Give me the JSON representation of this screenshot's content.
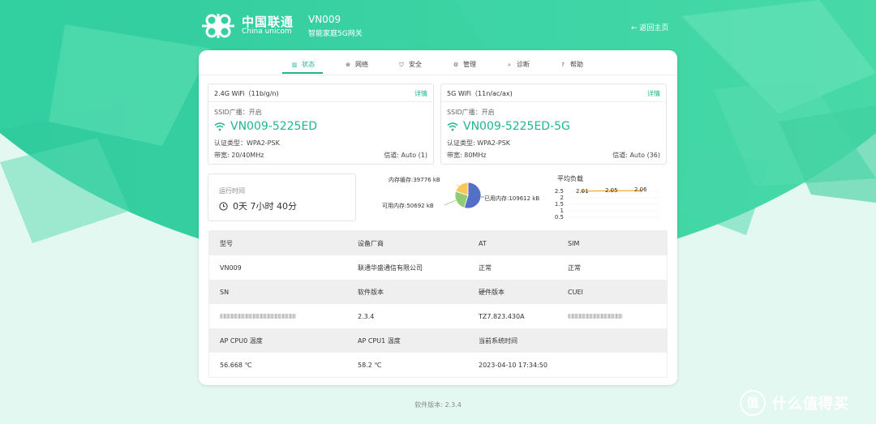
{
  "brand": {
    "name_cn": "中国联通",
    "name_en": "China unicom"
  },
  "device": {
    "model": "VN009",
    "subtitle": "智能家庭5G网关"
  },
  "nav": {
    "back_label": "返回主页"
  },
  "tabs": [
    {
      "label": "状态",
      "icon": "bar-chart-icon",
      "active": true
    },
    {
      "label": "网络",
      "icon": "globe-icon"
    },
    {
      "label": "安全",
      "icon": "shield-icon"
    },
    {
      "label": "管理",
      "icon": "gear-icon"
    },
    {
      "label": "诊断",
      "icon": "search-icon"
    },
    {
      "label": "帮助",
      "icon": "help-icon"
    }
  ],
  "wifi_24": {
    "title": "2.4G WiFi（11b/g/n)",
    "detail": "详情",
    "ssid_broadcast": "SSID广播：开启",
    "ssid": "VN009-5225ED",
    "auth": "认证类型：WPA2-PSK",
    "bandwidth": "带宽: 20/40MHz",
    "channel": "信道: Auto (1)"
  },
  "wifi_5": {
    "title": "5G WiFi（11n/ac/ax)",
    "detail": "详情",
    "ssid_broadcast": "SSID广播：开启",
    "ssid": "VN009-5225ED-5G",
    "auth": "认证类型: WPA2-PSK",
    "bandwidth": "带宽: 80MHz",
    "channel": "信道: Auto (36)"
  },
  "uptime": {
    "label": "运行时间",
    "value": "0天 7小时 40分"
  },
  "memory": {
    "labels": {
      "cache": "内存缓存:39776 kB",
      "available": "可用内存:50692 kB",
      "used": "已用内存:109612 kB"
    },
    "values_kb": {
      "cache": 39776,
      "available": 50692,
      "used": 109612
    },
    "colors": {
      "used": "#5470c6",
      "available": "#91cc75",
      "cache": "#fac858"
    }
  },
  "load_avg": {
    "title": "平均负载",
    "y_ticks": [
      "2.5",
      "2",
      "1.5",
      "1",
      "0.5"
    ],
    "points": [
      "2.01",
      "2.05",
      "2.06"
    ],
    "values": [
      2.01,
      2.05,
      2.06
    ],
    "ylim": [
      0,
      2.5
    ],
    "color": "#f5a623"
  },
  "info_table": {
    "rows": [
      {
        "type": "h",
        "cells": [
          "型号",
          "设备厂商",
          "AT",
          "SIM"
        ]
      },
      {
        "type": "v",
        "cells": [
          "VN009",
          "联通华盛通信有限公司",
          "正常",
          "正常"
        ]
      },
      {
        "type": "h",
        "cells": [
          "SN",
          "软件版本",
          "硬件版本",
          "CUEI"
        ]
      },
      {
        "type": "v",
        "cells": [
          "",
          "2.3.4",
          "TZ7.823.430A",
          ""
        ]
      },
      {
        "type": "h",
        "cells": [
          "AP CPU0 温度",
          "AP CPU1 温度",
          "当前系统时间",
          ""
        ]
      },
      {
        "type": "v",
        "cells": [
          "56.668 ℃",
          "58.2 ℃",
          "2023-04-10 17:34:50",
          ""
        ]
      }
    ]
  },
  "footer": {
    "version": "软件版本: 2.3.4"
  },
  "watermark": {
    "badge": "值",
    "text": "什么值得买"
  },
  "colors": {
    "accent": "#1fb592",
    "header_bg": "#2fd3a4"
  }
}
